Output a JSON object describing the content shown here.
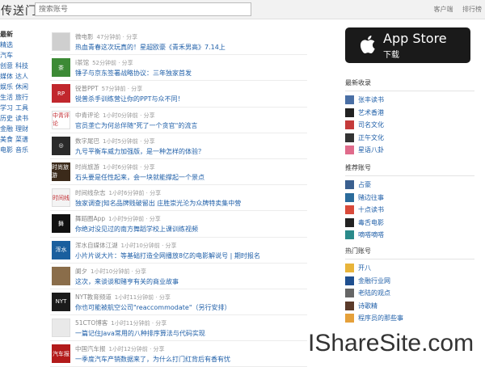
{
  "header": {
    "logo": "传送门",
    "search_placeholder": "搜索账号",
    "links": [
      "客户端",
      "排行榜"
    ]
  },
  "leftnav": {
    "heading": "最新",
    "rows": [
      [
        "精选"
      ],
      [
        "汽车"
      ],
      [
        "创意",
        "科技"
      ],
      [
        "媒体",
        "达人"
      ],
      [
        "娱乐",
        "休闲"
      ],
      [
        "生活",
        "旅行"
      ],
      [
        "学习",
        "工具"
      ],
      [
        "历史",
        "读书"
      ],
      [
        "金融",
        "理财"
      ],
      [
        "美食",
        "菜谱"
      ],
      [
        "电影",
        "音乐"
      ]
    ]
  },
  "feed": [
    {
      "source": "微电影",
      "meta": "47分钟前 · 分享",
      "title": "热血青春这次玩真的！星超欧豪《青禾男高》7.14上",
      "thumb_color": "#cfcfcf",
      "thumb_text": ""
    },
    {
      "source": "i茶馆",
      "meta": "52分钟前 · 分享",
      "title": "锤子与京东签署战略协议：三年独家首发",
      "thumb_color": "#3c8a35",
      "thumb_text": "茶"
    },
    {
      "source": "锐普PPT",
      "meta": "57分钟前 · 分享",
      "title": "锐普杀手训练营让你的PPT与众不同！",
      "thumb_color": "#c1272d",
      "thumb_text": "RP"
    },
    {
      "source": "中青评论",
      "meta": "1小时0分钟前 · 分享",
      "title": "官员垄亡为何总伴随\"死了一个贪官\"的流言",
      "thumb_color": "#ffffff",
      "thumb_text": "中青评论"
    },
    {
      "source": "数字尾巴",
      "meta": "1小时5分钟前 · 分享",
      "title": "九号平衡车威力加强版，是一种怎样的体验？",
      "thumb_color": "#2a2a2a",
      "thumb_text": "◎"
    },
    {
      "source": "时尚旅游",
      "meta": "1小时6分钟前 · 分享",
      "title": "石头要是任性起来，会一块就能撑起一个景点",
      "thumb_color": "#3b2a1a",
      "thumb_text": "时尚旅游"
    },
    {
      "source": "时间线杂志",
      "meta": "1小时6分钟前 · 分享",
      "title": "独家调查|知名品牌贱破留出 庄胜崇光沦为众牌特卖集中营",
      "thumb_color": "#f4f4f4",
      "thumb_text": "时间线"
    },
    {
      "source": "舞蹈圈App",
      "meta": "1小时9分钟前 · 分享",
      "title": "你绝对没见过的南方舞蹈学校上课训练视频",
      "thumb_color": "#111111",
      "thumb_text": "舞"
    },
    {
      "source": "浑水自媒体江湖",
      "meta": "1小时10分钟前 · 分享",
      "title": "小片片说大片：等基础打造全网播放8亿的电影解说号 | 期时报名",
      "thumb_color": "#1a5f9e",
      "thumb_text": "浑水"
    },
    {
      "source": "阑夕",
      "meta": "1小时10分钟前 · 分享",
      "title": "这次，来谈谈和赌亨有关的商业故事",
      "thumb_color": "#8a6d4a",
      "thumb_text": ""
    },
    {
      "source": "NYT教育频道",
      "meta": "1小时11分钟前 · 分享",
      "title": "你也可能被航空公司\"reaccommodate\"（另行安排）",
      "thumb_color": "#1b1b1b",
      "thumb_text": "NYT"
    },
    {
      "source": "51CTO博客",
      "meta": "1小时11分钟前 · 分享",
      "title": "一篇记住Java常用的八种排序算法与代码实现",
      "thumb_color": "#e9e9e9",
      "thumb_text": ""
    },
    {
      "source": "中国汽车报",
      "meta": "1小时12分钟前 · 分享",
      "title": "一季度汽车产销数据来了，为什么打门红背后有香有忧",
      "thumb_color": "#b31b1b",
      "thumb_text": "汽车报"
    }
  ],
  "appstore": {
    "big": "App Store",
    "small": "下载"
  },
  "sidebar": [
    {
      "heading": "最新收录",
      "items": [
        {
          "name": "张丰读书",
          "color": "#4a6fa5"
        },
        {
          "name": "艺术香港",
          "color": "#222222"
        },
        {
          "name": "司名文化",
          "color": "#c43a3a"
        },
        {
          "name": "正午文化",
          "color": "#333333"
        },
        {
          "name": "星语八卦",
          "color": "#e06b8b"
        }
      ]
    },
    {
      "heading": "推荐账号",
      "items": [
        {
          "name": "占豪",
          "color": "#3a5f8f"
        },
        {
          "name": "赌边往事",
          "color": "#2a6b9b"
        },
        {
          "name": "十点读书",
          "color": "#d94a3a"
        },
        {
          "name": "毒舌电影",
          "color": "#222222"
        },
        {
          "name": "嘀嗒嘀嗒",
          "color": "#2a8a8a"
        }
      ]
    },
    {
      "heading": "热门账号",
      "items": [
        {
          "name": "开八",
          "color": "#e8b43a"
        },
        {
          "name": "金融行业网",
          "color": "#1f4f8f"
        },
        {
          "name": "老陆的观点",
          "color": "#666666"
        },
        {
          "name": "诗歌精",
          "color": "#5a3a2a"
        },
        {
          "name": "程序员的那些事",
          "color": "#e5a03a"
        }
      ]
    }
  ],
  "watermark": "IShareSite.com"
}
